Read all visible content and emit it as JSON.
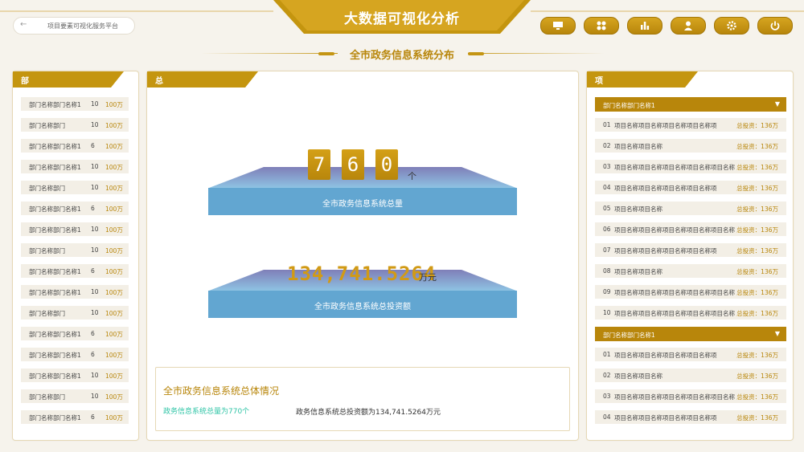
{
  "header": {
    "title": "大数据可视化分析",
    "back_label": "项目要素可视化服务平台",
    "toolbar": [
      {
        "icon": "monitor-icon"
      },
      {
        "icon": "apps-grid-icon"
      },
      {
        "icon": "bar-chart-icon"
      },
      {
        "icon": "user-icon"
      },
      {
        "icon": "gear-icon"
      },
      {
        "icon": "power-icon"
      }
    ]
  },
  "subtitle": "全市政务信息系统分布",
  "departments": {
    "title": "部门列表",
    "rows": [
      {
        "name": "部门名称部门名称1",
        "count": "10",
        "amount": "100万"
      },
      {
        "name": "部门名称部门",
        "count": "10",
        "amount": "100万"
      },
      {
        "name": "部门名称部门名称1",
        "count": "6",
        "amount": "100万"
      },
      {
        "name": "部门名称部门名称1",
        "count": "10",
        "amount": "100万"
      },
      {
        "name": "部门名称部门",
        "count": "10",
        "amount": "100万"
      },
      {
        "name": "部门名称部门名称1",
        "count": "6",
        "amount": "100万"
      },
      {
        "name": "部门名称部门名称1",
        "count": "10",
        "amount": "100万"
      },
      {
        "name": "部门名称部门",
        "count": "10",
        "amount": "100万"
      },
      {
        "name": "部门名称部门名称1",
        "count": "6",
        "amount": "100万"
      },
      {
        "name": "部门名称部门名称1",
        "count": "10",
        "amount": "100万"
      },
      {
        "name": "部门名称部门",
        "count": "10",
        "amount": "100万"
      },
      {
        "name": "部门名称部门名称1",
        "count": "6",
        "amount": "100万"
      },
      {
        "name": "部门名称部门名称1",
        "count": "6",
        "amount": "100万"
      },
      {
        "name": "部门名称部门名称1",
        "count": "10",
        "amount": "100万"
      },
      {
        "name": "部门名称部门",
        "count": "10",
        "amount": "100万"
      },
      {
        "name": "部门名称部门名称1",
        "count": "6",
        "amount": "100万"
      }
    ]
  },
  "overview": {
    "title": "总体情况",
    "system_count_digits": [
      "7",
      "6",
      "0"
    ],
    "system_count_unit": "个",
    "system_count_label": "全市政务信息系统总量",
    "investment_value": "134,741.5264",
    "investment_unit": "万元",
    "investment_label": "全市政务信息系统总投资额",
    "summary_title": "全市政务信息系统总体情况",
    "summary_count_text": "政务信息系统总量为770个",
    "summary_investment_text": "政务信息系统总投资额为134,741.5264万元"
  },
  "projects": {
    "title": "项目列表",
    "groups": [
      {
        "name": "部门名称部门名称1",
        "items": [
          {
            "idx": "01",
            "name": "项目名称项目名称项目名称项目名称项",
            "investment": "总投资：136万"
          },
          {
            "idx": "02",
            "name": "项目名称项目名称",
            "investment": "总投资：136万"
          },
          {
            "idx": "03",
            "name": "项目名称项目名称项目名称项目名称项目名称",
            "investment": "总投资：136万"
          },
          {
            "idx": "04",
            "name": "项目名称项目名称项目名称项目名称项",
            "investment": "总投资：136万"
          },
          {
            "idx": "05",
            "name": "项目名称项目名称",
            "investment": "总投资：136万"
          },
          {
            "idx": "06",
            "name": "项目名称项目名称项目名称项目名称项目名称",
            "investment": "总投资：136万"
          },
          {
            "idx": "07",
            "name": "项目名称项目名称项目名称项目名称项",
            "investment": "总投资：136万"
          },
          {
            "idx": "08",
            "name": "项目名称项目名称",
            "investment": "总投资：136万"
          },
          {
            "idx": "09",
            "name": "项目名称项目名称项目名称项目名称项目名称",
            "investment": "总投资：136万"
          },
          {
            "idx": "10",
            "name": "项目名称项目名称项目名称项目名称项目名称",
            "investment": "总投资：136万"
          }
        ]
      },
      {
        "name": "部门名称部门名称1",
        "items": [
          {
            "idx": "01",
            "name": "项目名称项目名称项目名称项目名称项",
            "investment": "总投资：136万"
          },
          {
            "idx": "02",
            "name": "项目名称项目名称",
            "investment": "总投资：136万"
          },
          {
            "idx": "03",
            "name": "项目名称项目名称项目名称项目名称项目名称",
            "investment": "总投资：136万"
          },
          {
            "idx": "04",
            "name": "项目名称项目名称项目名称项目名称项",
            "investment": "总投资：136万"
          }
        ]
      }
    ]
  },
  "colors": {
    "accent": "#b8860b",
    "slab": "#6aaad6",
    "highlight": "#2ec4a6"
  }
}
